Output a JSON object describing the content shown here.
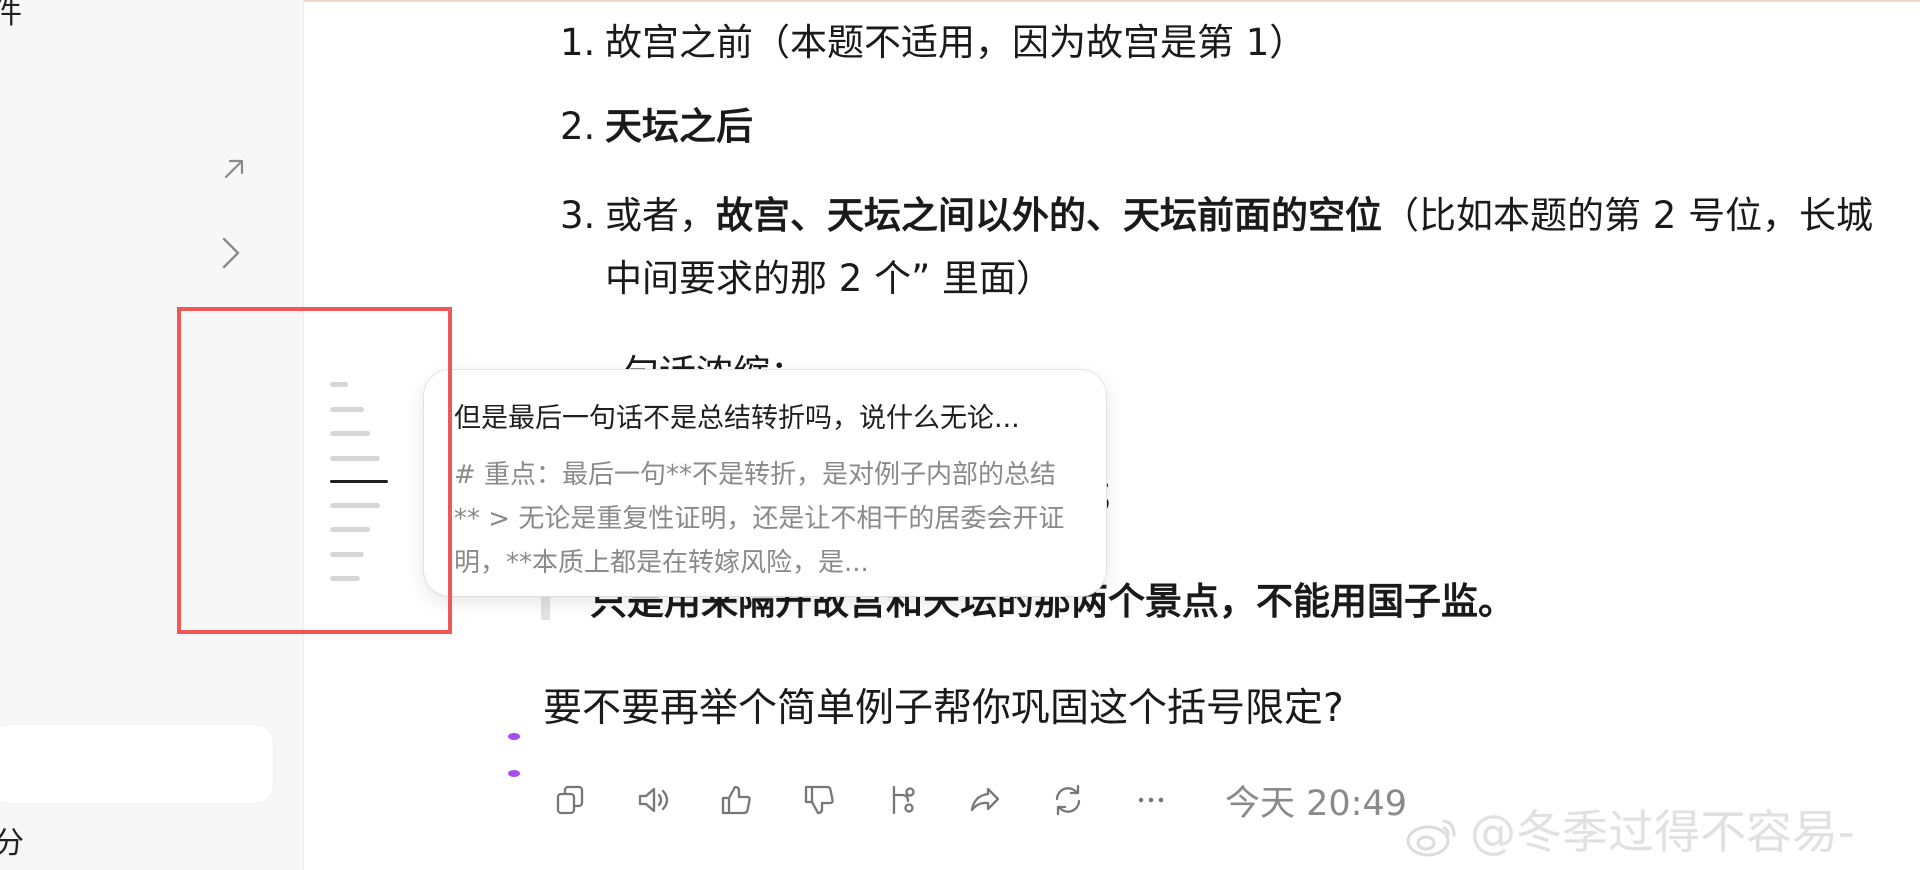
{
  "sidebar": {
    "cut_text_top": "件",
    "cut_text_bottom": "分"
  },
  "message": {
    "list_items": [
      {
        "num": "1.",
        "segments": [
          {
            "text": "故宫之前（本题不适用，因为故宫是第 1）",
            "bold": false
          }
        ]
      },
      {
        "num": "2.",
        "segments": [
          {
            "text": "天坛之后",
            "bold": true
          }
        ]
      },
      {
        "num": "3.",
        "segments": [
          {
            "text": "或者，",
            "bold": false
          },
          {
            "text": "故宫、天坛之间以外的、天坛前面的空位",
            "bold": true
          },
          {
            "text": "（比如本题的第 2 号位，长城",
            "bold": false
          }
        ]
      }
    ],
    "item3_continuation": "中间要求的那 2 个” 里面）",
    "partial_line": "一句话浓缩：",
    "semicolon_line": "；",
    "quote": "只是用来隔开故宫和天坛的那两个景点，不能用国子监。",
    "question": "要不要再举个简单例子帮你巩固这个括号限定?"
  },
  "popover": {
    "title": "但是最后一句话不是总结转折吗，说什么无论...",
    "body": "# 重点：最后一句**不是转折，是对例子内部的总结** > 无论是重复性证明，还是让不相干的居委会开证明，**本质上都是在转嫁风险，是..."
  },
  "toolbar": {
    "icons": [
      "copy-icon",
      "speaker-icon",
      "thumbs-up-icon",
      "thumbs-down-icon",
      "branch-icon",
      "share-icon",
      "regenerate-icon",
      "more-icon"
    ],
    "timestamp": "今天 20:49"
  },
  "watermark": "@冬季过得不容易-",
  "colors": {
    "highlight_box": "#f05757",
    "accent_dots": "#a64df0",
    "sidebar_bg": "#f7f7f8",
    "muted_text": "#8a8a8a"
  }
}
